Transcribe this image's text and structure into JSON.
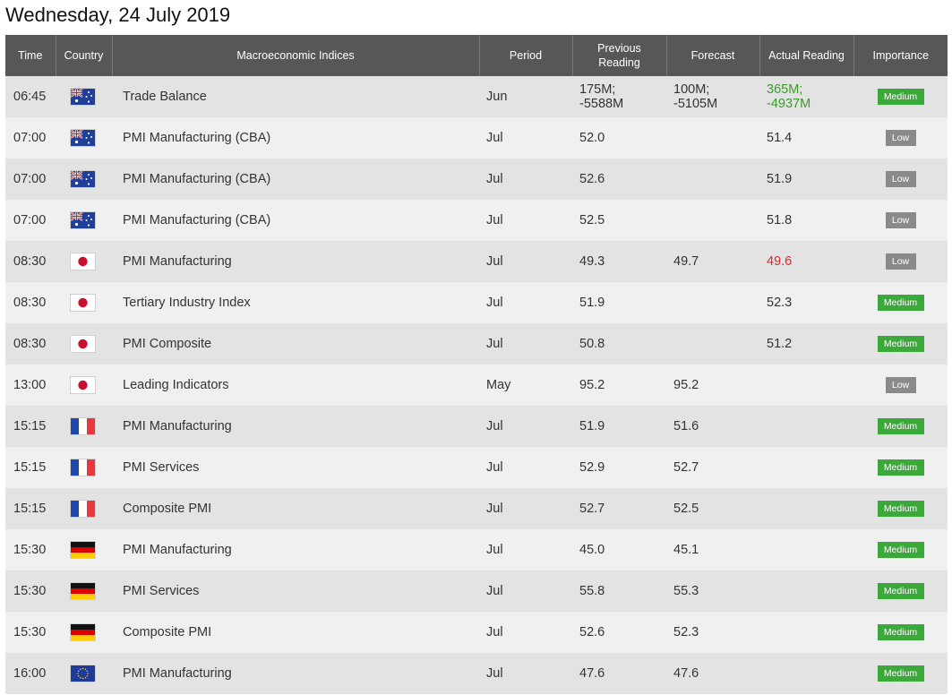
{
  "page_title": "Wednesday, 24 July 2019",
  "columns": {
    "time": "Time",
    "country": "Country",
    "indices": "Macroeconomic Indices",
    "period": "Period",
    "previous_line1": "Previous",
    "previous_line2": "Reading",
    "forecast": "Forecast",
    "actual": "Actual Reading",
    "importance": "Importance"
  },
  "colors": {
    "positive": "#3a9a2a",
    "negative": "#d82a2a",
    "medium_badge": "#3aa93a",
    "low_badge": "#8a8a8a",
    "header_bg": "#575757"
  },
  "rows": [
    {
      "time": "06:45",
      "country_flag": "australia-flag-icon",
      "index": "Trade Balance",
      "period": "Jun",
      "prev1": "175M;",
      "prev2": "-5588M",
      "fc1": "100M;",
      "fc2": "-5105M",
      "act1": "365M;",
      "act2": "-4937M",
      "act_tone": "green",
      "importance": "Medium"
    },
    {
      "time": "07:00",
      "country_flag": "australia-flag-icon",
      "index": "PMI Manufacturing (CBA)",
      "period": "Jul",
      "prev1": "52.0",
      "prev2": "",
      "fc1": "",
      "fc2": "",
      "act1": "51.4",
      "act2": "",
      "act_tone": "",
      "importance": "Low"
    },
    {
      "time": "07:00",
      "country_flag": "australia-flag-icon",
      "index": "PMI Manufacturing (CBA)",
      "period": "Jul",
      "prev1": "52.6",
      "prev2": "",
      "fc1": "",
      "fc2": "",
      "act1": "51.9",
      "act2": "",
      "act_tone": "",
      "importance": "Low"
    },
    {
      "time": "07:00",
      "country_flag": "australia-flag-icon",
      "index": "PMI Manufacturing (CBA)",
      "period": "Jul",
      "prev1": "52.5",
      "prev2": "",
      "fc1": "",
      "fc2": "",
      "act1": "51.8",
      "act2": "",
      "act_tone": "",
      "importance": "Low"
    },
    {
      "time": "08:30",
      "country_flag": "japan-flag-icon",
      "index": "PMI Manufacturing",
      "period": "Jul",
      "prev1": "49.3",
      "prev2": "",
      "fc1": "49.7",
      "fc2": "",
      "act1": "49.6",
      "act2": "",
      "act_tone": "red",
      "importance": "Low"
    },
    {
      "time": "08:30",
      "country_flag": "japan-flag-icon",
      "index": "Tertiary Industry Index",
      "period": "Jul",
      "prev1": "51.9",
      "prev2": "",
      "fc1": "",
      "fc2": "",
      "act1": "52.3",
      "act2": "",
      "act_tone": "",
      "importance": "Medium"
    },
    {
      "time": "08:30",
      "country_flag": "japan-flag-icon",
      "index": "PMI Composite",
      "period": "Jul",
      "prev1": "50.8",
      "prev2": "",
      "fc1": "",
      "fc2": "",
      "act1": "51.2",
      "act2": "",
      "act_tone": "",
      "importance": "Medium"
    },
    {
      "time": "13:00",
      "country_flag": "japan-flag-icon",
      "index": "Leading Indicators",
      "period": "May",
      "prev1": "95.2",
      "prev2": "",
      "fc1": "95.2",
      "fc2": "",
      "act1": "",
      "act2": "",
      "act_tone": "",
      "importance": "Low"
    },
    {
      "time": "15:15",
      "country_flag": "france-flag-icon",
      "index": "PMI Manufacturing",
      "period": "Jul",
      "prev1": "51.9",
      "prev2": "",
      "fc1": "51.6",
      "fc2": "",
      "act1": "",
      "act2": "",
      "act_tone": "",
      "importance": "Medium"
    },
    {
      "time": "15:15",
      "country_flag": "france-flag-icon",
      "index": "PMI Services",
      "period": "Jul",
      "prev1": "52.9",
      "prev2": "",
      "fc1": "52.7",
      "fc2": "",
      "act1": "",
      "act2": "",
      "act_tone": "",
      "importance": "Medium"
    },
    {
      "time": "15:15",
      "country_flag": "france-flag-icon",
      "index": "Composite PMI",
      "period": "Jul",
      "prev1": "52.7",
      "prev2": "",
      "fc1": "52.5",
      "fc2": "",
      "act1": "",
      "act2": "",
      "act_tone": "",
      "importance": "Medium"
    },
    {
      "time": "15:30",
      "country_flag": "germany-flag-icon",
      "index": "PMI Manufacturing",
      "period": "Jul",
      "prev1": "45.0",
      "prev2": "",
      "fc1": "45.1",
      "fc2": "",
      "act1": "",
      "act2": "",
      "act_tone": "",
      "importance": "Medium"
    },
    {
      "time": "15:30",
      "country_flag": "germany-flag-icon",
      "index": "PMI Services",
      "period": "Jul",
      "prev1": "55.8",
      "prev2": "",
      "fc1": "55.3",
      "fc2": "",
      "act1": "",
      "act2": "",
      "act_tone": "",
      "importance": "Medium"
    },
    {
      "time": "15:30",
      "country_flag": "germany-flag-icon",
      "index": "Composite PMI",
      "period": "Jul",
      "prev1": "52.6",
      "prev2": "",
      "fc1": "52.3",
      "fc2": "",
      "act1": "",
      "act2": "",
      "act_tone": "",
      "importance": "Medium"
    },
    {
      "time": "16:00",
      "country_flag": "eu-flag-icon",
      "index": "PMI Manufacturing",
      "period": "Jul",
      "prev1": "47.6",
      "prev2": "",
      "fc1": "47.6",
      "fc2": "",
      "act1": "",
      "act2": "",
      "act_tone": "",
      "importance": "Medium"
    }
  ]
}
